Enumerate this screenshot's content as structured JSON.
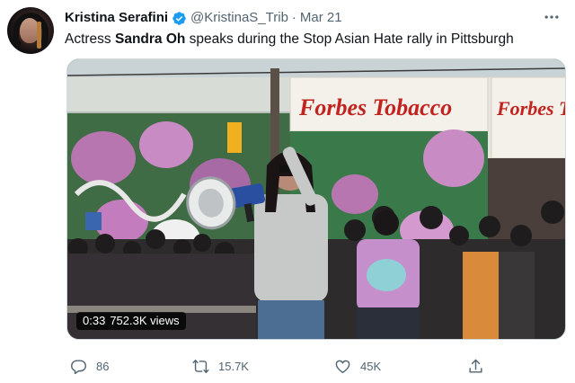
{
  "tweet": {
    "author": {
      "name": "Kristina Serafini",
      "handle": "@KristinaS_Trib",
      "verified": true
    },
    "separator": "·",
    "date": "Mar 21",
    "text_before": "Actress ",
    "text_bold": "Sandra Oh",
    "text_after": " speaks during the Stop Asian Hate rally in Pittsburgh",
    "media": {
      "duration": "0:33",
      "views": "752.3K views",
      "sign_left": "Forbes Tobacco",
      "sign_right": "Forbes Tob"
    },
    "actions": {
      "replies": "86",
      "retweets": "15.7K",
      "likes": "45K"
    }
  },
  "icons": {
    "more": "more-horizontal-icon",
    "reply": "reply-icon",
    "retweet": "retweet-icon",
    "like": "heart-icon",
    "share": "share-icon",
    "verified": "verified-badge-icon"
  },
  "colors": {
    "text": "#0f1419",
    "secondary": "#536471",
    "verified": "#1d9bf0",
    "border": "#cfd9de"
  }
}
